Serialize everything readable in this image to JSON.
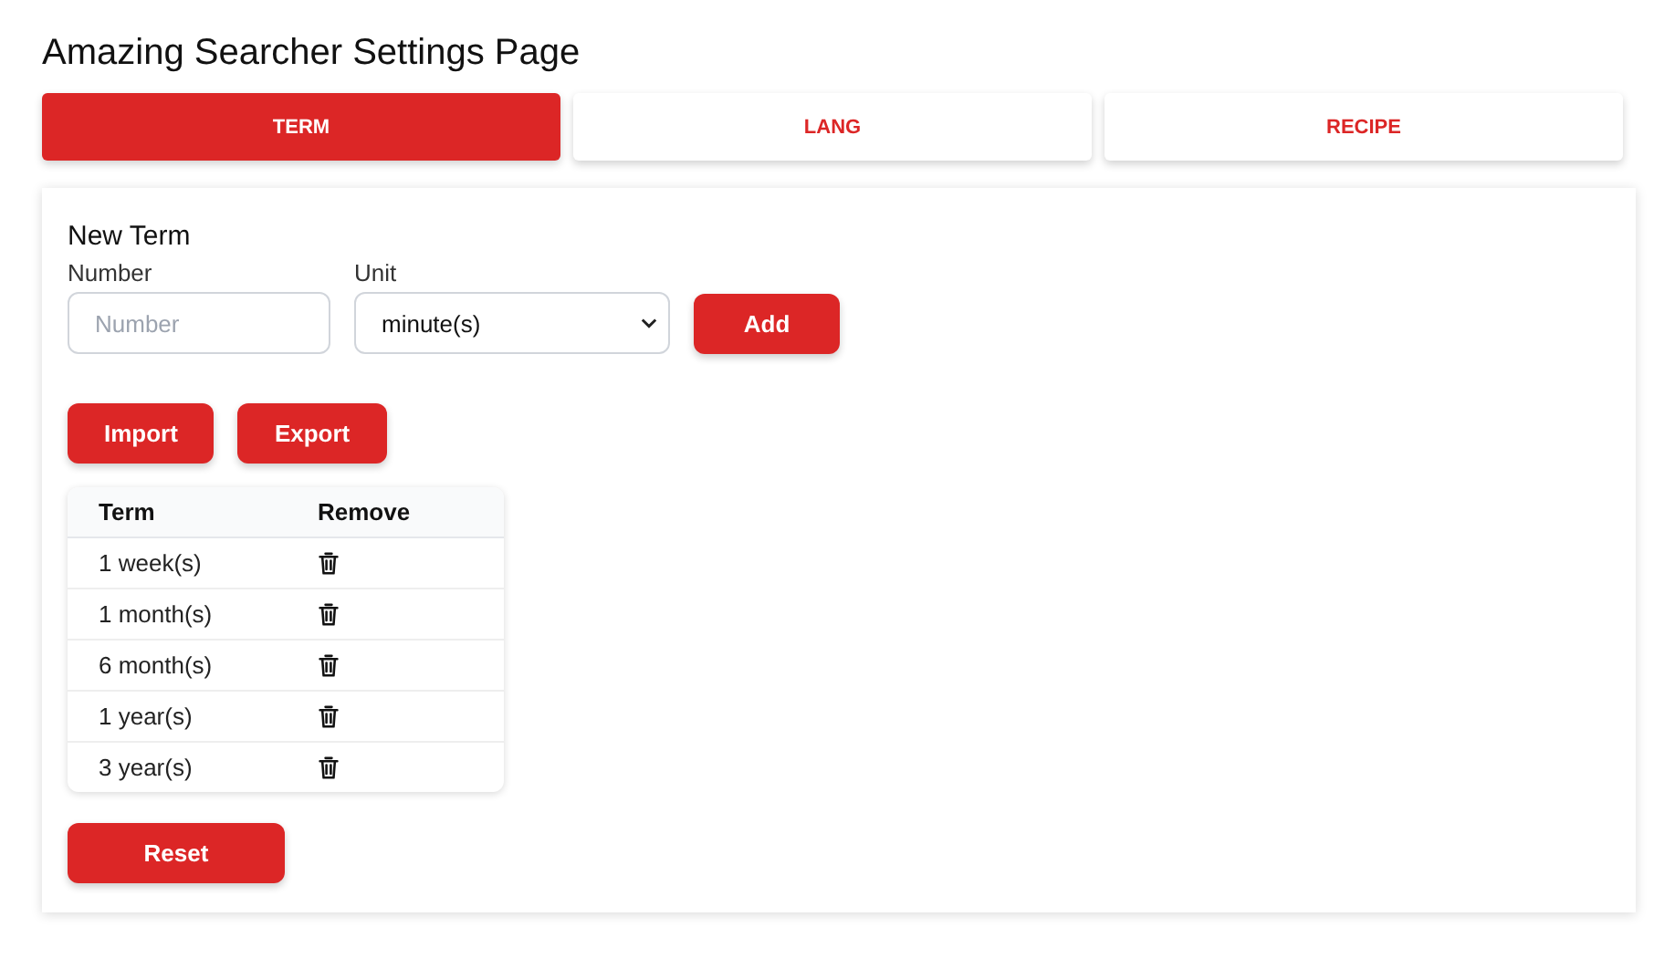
{
  "page": {
    "title": "Amazing Searcher Settings Page"
  },
  "tabs": [
    {
      "label": "TERM",
      "selected": true
    },
    {
      "label": "LANG",
      "selected": false
    },
    {
      "label": "RECIPE",
      "selected": false
    }
  ],
  "new_term": {
    "heading": "New Term",
    "number_label": "Number",
    "number_placeholder": "Number",
    "unit_label": "Unit",
    "unit_value": "minute(s)",
    "add_button": "Add"
  },
  "actions": [
    "Import",
    "Export"
  ],
  "table": {
    "columns": [
      "Term",
      "Remove"
    ],
    "rows": [
      {
        "term": "1 week(s)"
      },
      {
        "term": "1 month(s)"
      },
      {
        "term": "6 month(s)"
      },
      {
        "term": "1 year(s)"
      },
      {
        "term": "3 year(s)"
      }
    ]
  },
  "reset_button": "Reset"
}
